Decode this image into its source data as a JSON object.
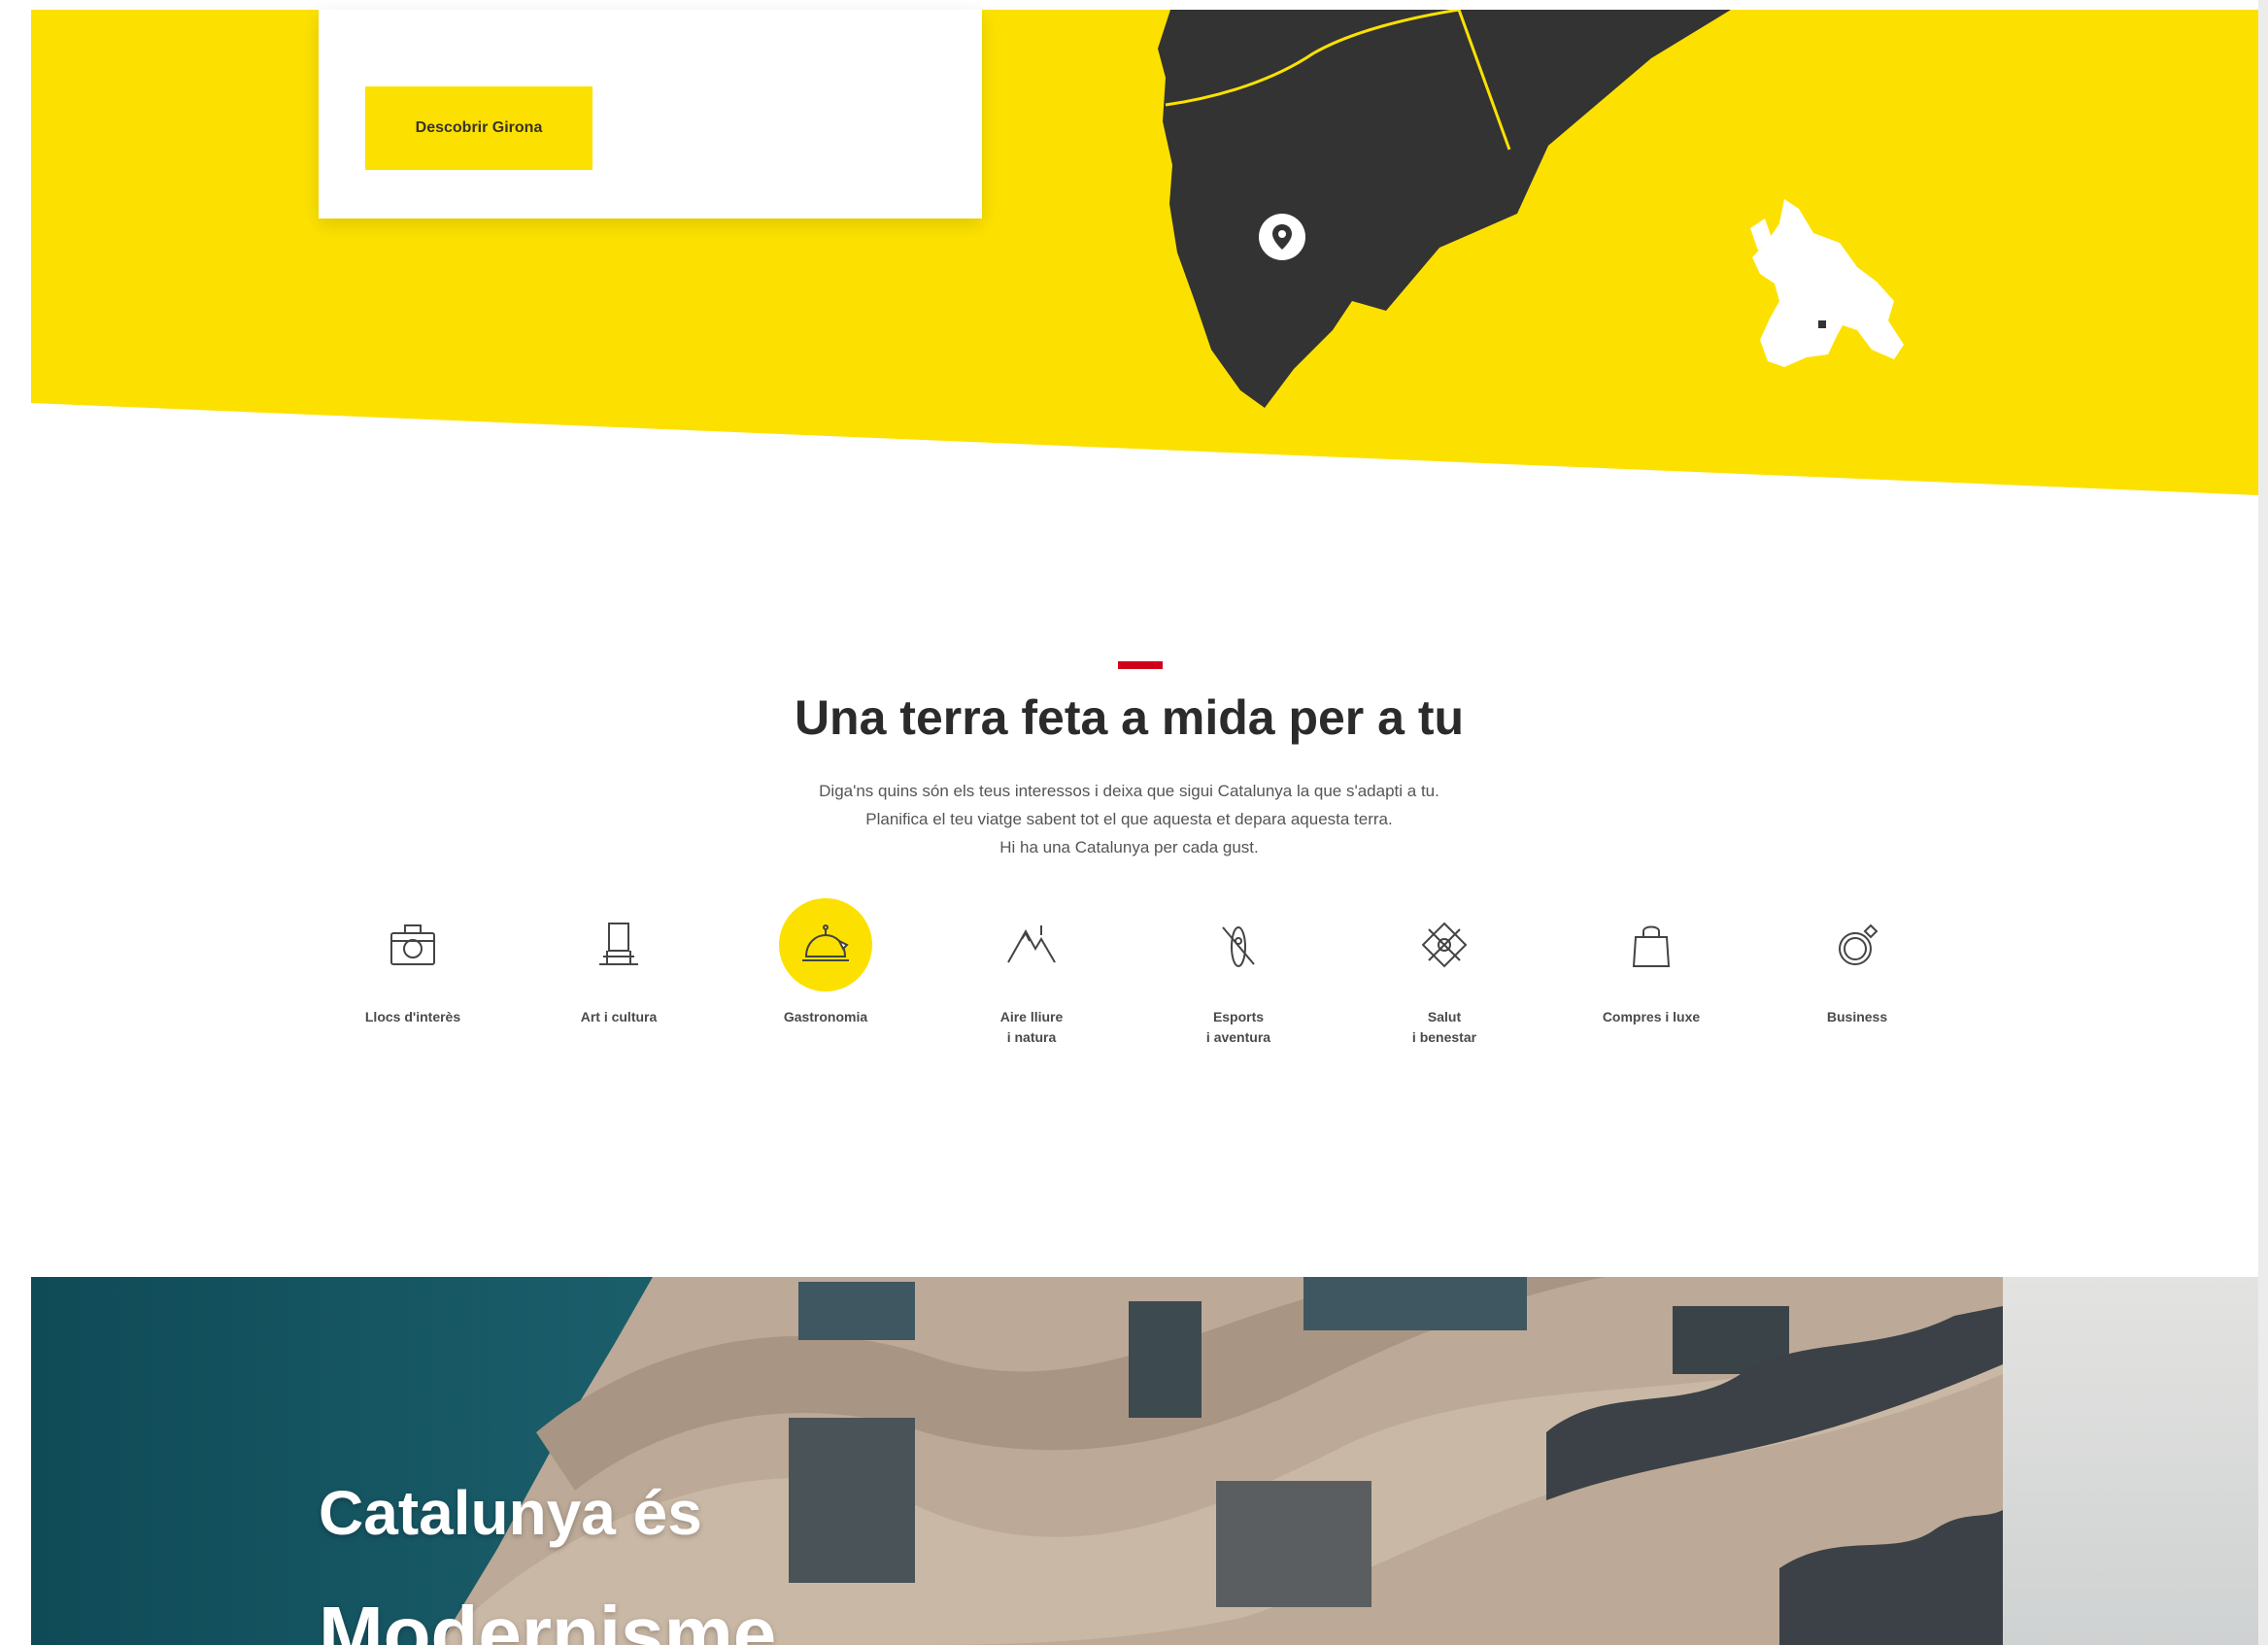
{
  "colors": {
    "brand_yellow": "#fce100",
    "map_dark": "#333333",
    "accent_red": "#d0021b",
    "teal": "#1a5a66"
  },
  "hero": {
    "discover_button": "Descobrir Girona",
    "map_marker_icon": "location-pin-icon",
    "europe_map_icon": "europe-map-icon"
  },
  "interests": {
    "title": "Una terra feta a mida per a tu",
    "description": [
      "Diga'ns quins són els teus interessos i deixa que sigui Catalunya la que s'adapti a tu.",
      "Planifica el teu viatge sabent tot el que aquesta et depara aquesta terra.",
      "Hi ha una Catalunya per cada gust."
    ],
    "categories": [
      {
        "label": "Llocs d'interès",
        "icon": "camera-icon",
        "active": false
      },
      {
        "label": "Art i cultura",
        "icon": "museum-icon",
        "active": false
      },
      {
        "label": "Gastronomia",
        "icon": "cloche-icon",
        "active": true
      },
      {
        "label": "Aire lliure\ni natura",
        "icon": "mountain-icon",
        "active": false
      },
      {
        "label": "Esports\ni aventura",
        "icon": "kayak-icon",
        "active": false
      },
      {
        "label": "Salut\ni benestar",
        "icon": "wellness-icon",
        "active": false
      },
      {
        "label": "Compres i luxe",
        "icon": "shopping-bag-icon",
        "active": false
      },
      {
        "label": "Business",
        "icon": "ring-icon",
        "active": false
      }
    ]
  },
  "promo": {
    "line1": "Catalunya és",
    "line2": "Modernisme"
  }
}
